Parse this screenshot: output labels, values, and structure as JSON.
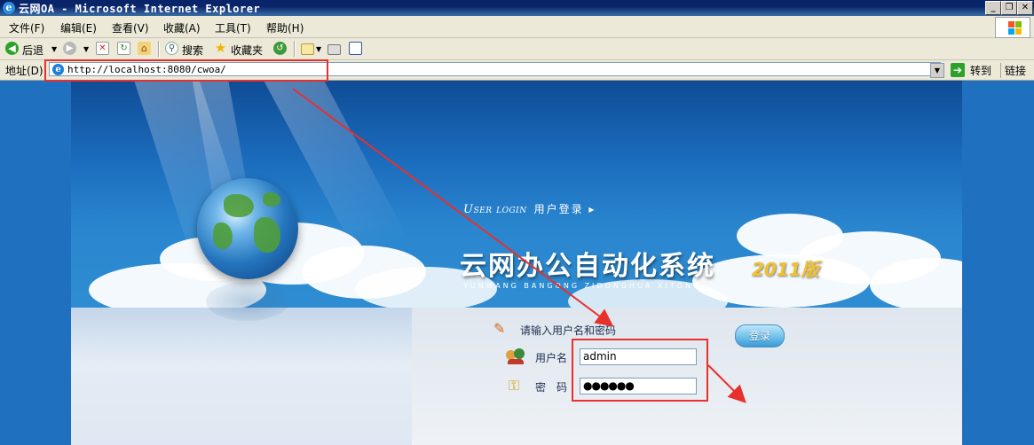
{
  "window": {
    "title": "云网OA - Microsoft Internet Explorer",
    "controls": [
      "_",
      "❐",
      "✕"
    ]
  },
  "menu": {
    "items": [
      "文件(F)",
      "编辑(E)",
      "查看(V)",
      "收藏(A)",
      "工具(T)",
      "帮助(H)"
    ]
  },
  "toolbar": {
    "back_label": "后退",
    "search_label": "搜索",
    "favorites_label": "收藏夹"
  },
  "address": {
    "label": "地址(D)",
    "url": "http://localhost:8080/cwoa/",
    "go_label": "转到",
    "links_label": "链接"
  },
  "banner": {
    "user_login_en": "User login",
    "user_login_cn": "用户登录 ▸",
    "system_title": "云网办公自动化系统",
    "system_year": "2011版",
    "system_pinyin": "YUNWANG BANGONG ZIDONGHUA XITONG"
  },
  "login_form": {
    "prompt": "请输入用户名和密码",
    "username_label": "用户名",
    "username_value": "admin",
    "password_label": "密　码",
    "password_value": "●●●●●●",
    "submit_label": "登录"
  },
  "colors": {
    "annotation": "#e8302c",
    "accent_year": "#f2c12e"
  }
}
